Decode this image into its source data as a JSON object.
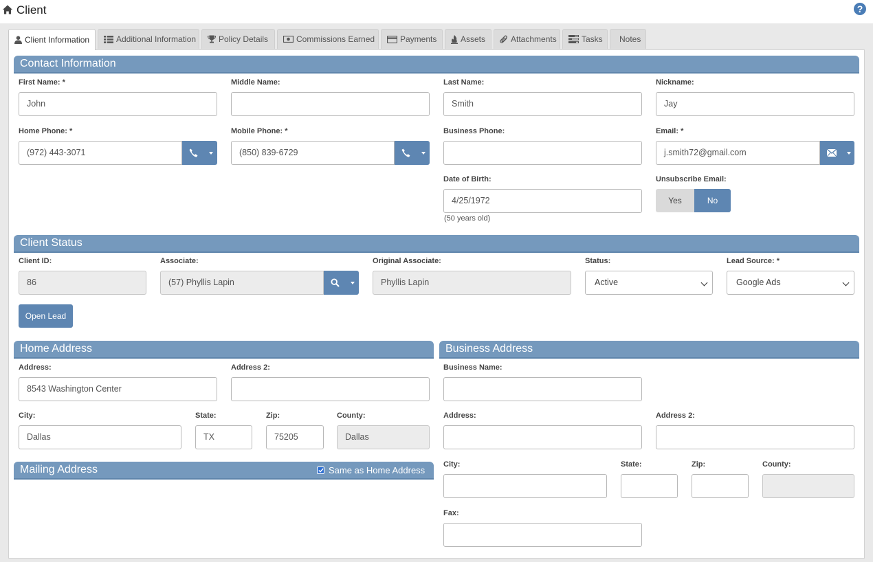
{
  "header": {
    "title": "Client"
  },
  "tabs": [
    {
      "label": "Client Information",
      "icon": "user-icon"
    },
    {
      "label": "Additional Information",
      "icon": "list-icon"
    },
    {
      "label": "Policy Details",
      "icon": "trophy-icon"
    },
    {
      "label": "Commissions Earned",
      "icon": "money-icon"
    },
    {
      "label": "Payments",
      "icon": "credit-card-icon"
    },
    {
      "label": "Assets",
      "icon": "fire-icon"
    },
    {
      "label": "Attachments",
      "icon": "paperclip-icon"
    },
    {
      "label": "Tasks",
      "icon": "tasks-icon"
    },
    {
      "label": "Notes",
      "icon": ""
    }
  ],
  "contact": {
    "section_title": "Contact Information",
    "first_name": {
      "label": "First Name: *",
      "value": "John"
    },
    "middle_name": {
      "label": "Middle Name:",
      "value": ""
    },
    "last_name": {
      "label": "Last Name:",
      "value": "Smith"
    },
    "nickname": {
      "label": "Nickname:",
      "value": "Jay"
    },
    "home_phone": {
      "label": "Home Phone: *",
      "value": "(972) 443-3071"
    },
    "mobile_phone": {
      "label": "Mobile Phone: *",
      "value": "(850) 839-6729"
    },
    "business_phone": {
      "label": "Business Phone:",
      "value": ""
    },
    "email": {
      "label": "Email: *",
      "value": "j.smith72@gmail.com"
    },
    "dob": {
      "label": "Date of Birth:",
      "value": "4/25/1972",
      "age_hint": "(50 years old)"
    },
    "unsubscribe": {
      "label": "Unsubscribe Email:",
      "yes": "Yes",
      "no": "No",
      "selected": "No"
    }
  },
  "status": {
    "section_title": "Client Status",
    "client_id": {
      "label": "Client ID:",
      "value": "86"
    },
    "associate": {
      "label": "Associate:",
      "value": "(57) Phyllis Lapin"
    },
    "original_associate": {
      "label": "Original Associate:",
      "value": "Phyllis Lapin"
    },
    "status": {
      "label": "Status:",
      "value": "Active"
    },
    "lead_source": {
      "label": "Lead Source: *",
      "value": "Google Ads"
    },
    "open_lead_button": "Open Lead"
  },
  "home_address": {
    "section_title": "Home Address",
    "address": {
      "label": "Address:",
      "value": "8543 Washington Center"
    },
    "address2": {
      "label": "Address 2:",
      "value": ""
    },
    "city": {
      "label": "City:",
      "value": "Dallas"
    },
    "state": {
      "label": "State:",
      "value": "TX"
    },
    "zip": {
      "label": "Zip:",
      "value": "75205"
    },
    "county": {
      "label": "County:",
      "value": "Dallas"
    }
  },
  "mailing_address": {
    "section_title": "Mailing Address",
    "same_as_home_label": "Same as Home Address",
    "same_as_home_checked": true
  },
  "business_address": {
    "section_title": "Business Address",
    "business_name": {
      "label": "Business Name:",
      "value": ""
    },
    "address": {
      "label": "Address:",
      "value": ""
    },
    "address2": {
      "label": "Address 2:",
      "value": ""
    },
    "city": {
      "label": "City:",
      "value": ""
    },
    "state": {
      "label": "State:",
      "value": ""
    },
    "zip": {
      "label": "Zip:",
      "value": ""
    },
    "county": {
      "label": "County:",
      "value": ""
    },
    "fax": {
      "label": "Fax:",
      "value": ""
    }
  },
  "colors": {
    "section_header": "#7599bd",
    "button": "#5e86b2",
    "help": "#4a7db6"
  }
}
